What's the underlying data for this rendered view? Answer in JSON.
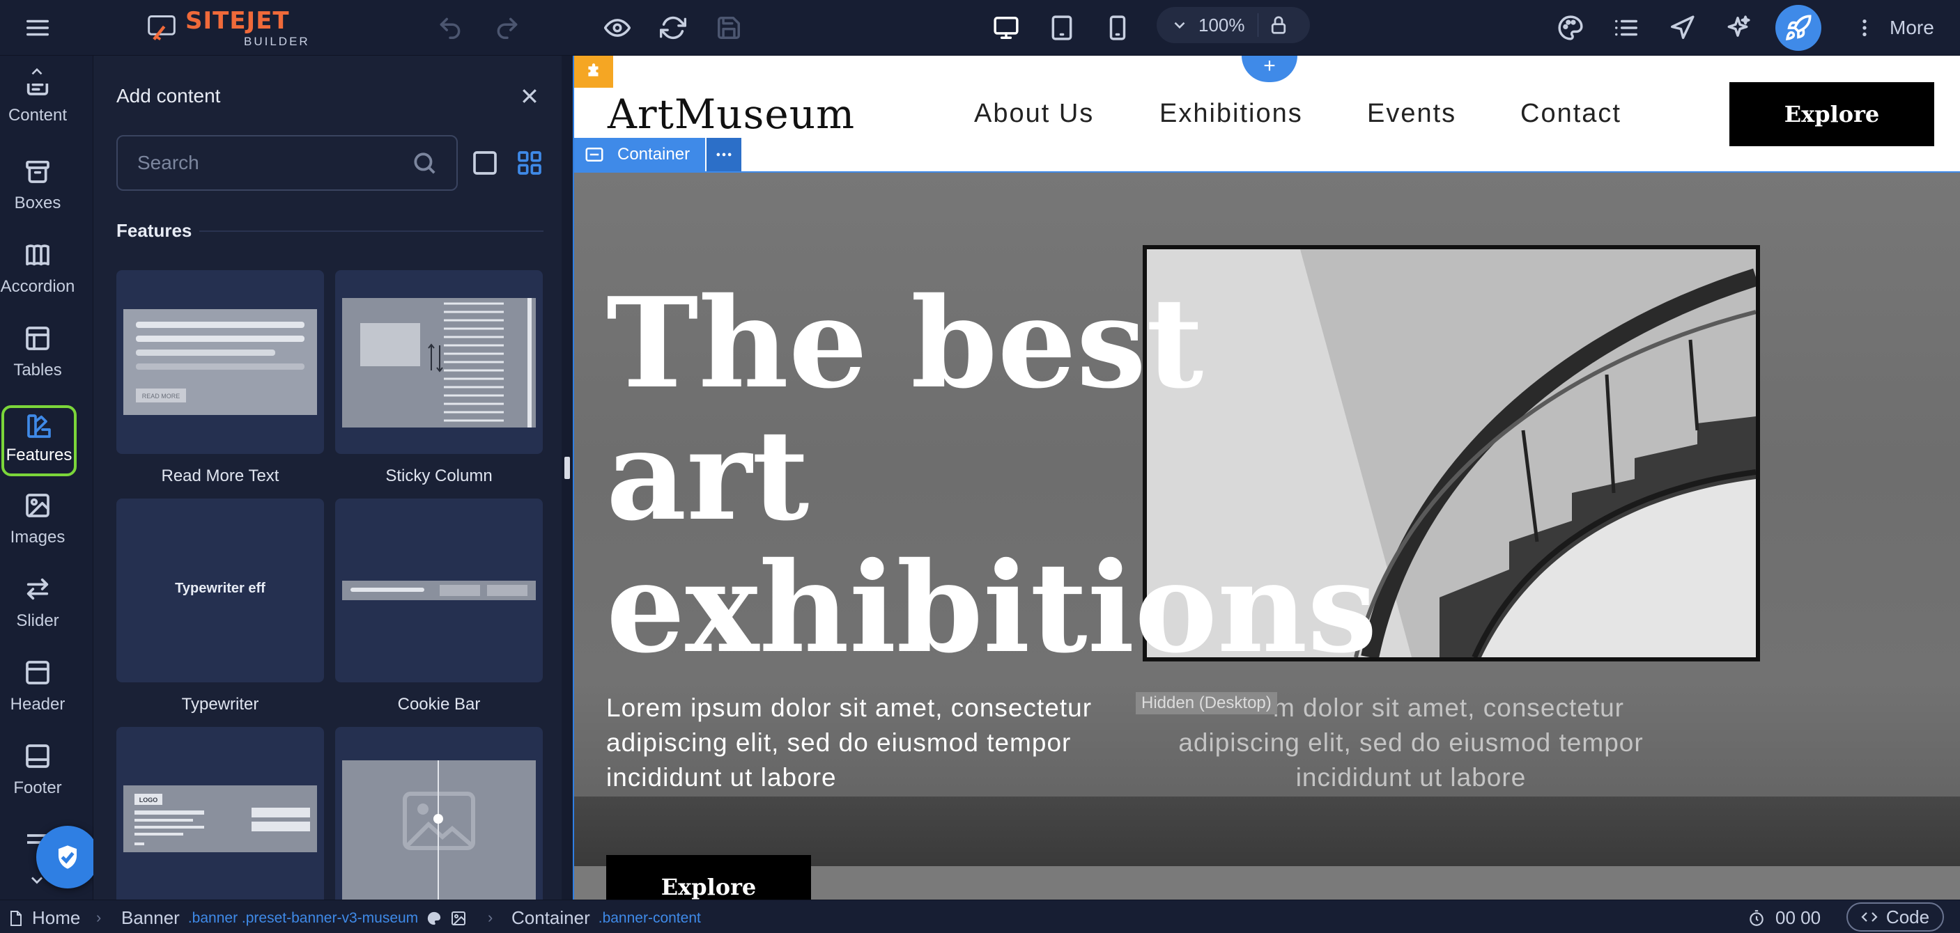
{
  "app": {
    "brand_main": "SITEJET",
    "brand_sub": "BUILDER",
    "zoom": "100%",
    "more_label": "More"
  },
  "rail": {
    "items": [
      {
        "label": "Content"
      },
      {
        "label": "Boxes"
      },
      {
        "label": "Accordion"
      },
      {
        "label": "Tables"
      },
      {
        "label": "Features"
      },
      {
        "label": "Images"
      },
      {
        "label": "Slider"
      },
      {
        "label": "Header"
      },
      {
        "label": "Footer"
      }
    ]
  },
  "panel": {
    "title": "Add content",
    "search_placeholder": "Search",
    "section": "Features",
    "cards": [
      {
        "label": "Read More Text",
        "thumb_button": "READ MORE"
      },
      {
        "label": "Sticky Column"
      },
      {
        "label": "Typewriter",
        "thumb_text": "Typewriter eff"
      },
      {
        "label": "Cookie Bar"
      },
      {
        "thumb_logo": "LOGO"
      }
    ]
  },
  "site": {
    "brand": "ArtMuseum",
    "nav": [
      "About Us",
      "Exhibitions",
      "Events",
      "Contact"
    ],
    "header_button": "Explore",
    "container_label": "Container",
    "add_icon": "+",
    "hero_title_lines": [
      "The best",
      "art",
      "exhibitions"
    ],
    "hero_text_lines": [
      "Lorem ipsum dolor sit amet, consectetur",
      "adipiscing elit, sed do eiusmod tempor",
      "incididunt ut labore"
    ],
    "hero_text2_lines": [
      "m dolor sit amet, consectetur",
      "adipiscing elit, sed do eiusmod tempor",
      "incididunt ut labore"
    ],
    "hidden_badge": "Hidden (Desktop)",
    "hero_button": "Explore"
  },
  "bottombar": {
    "home": "Home",
    "banner": "Banner",
    "banner_class": ".banner .preset-banner-v3-museum",
    "container": "Container",
    "container_class": ".banner-content",
    "timer": "00 00",
    "code": "Code"
  },
  "colors": {
    "accent": "#3f8ae8",
    "brand": "#f06a3a",
    "active_outline": "#7bd63a",
    "panel_bg": "#1a2136"
  }
}
